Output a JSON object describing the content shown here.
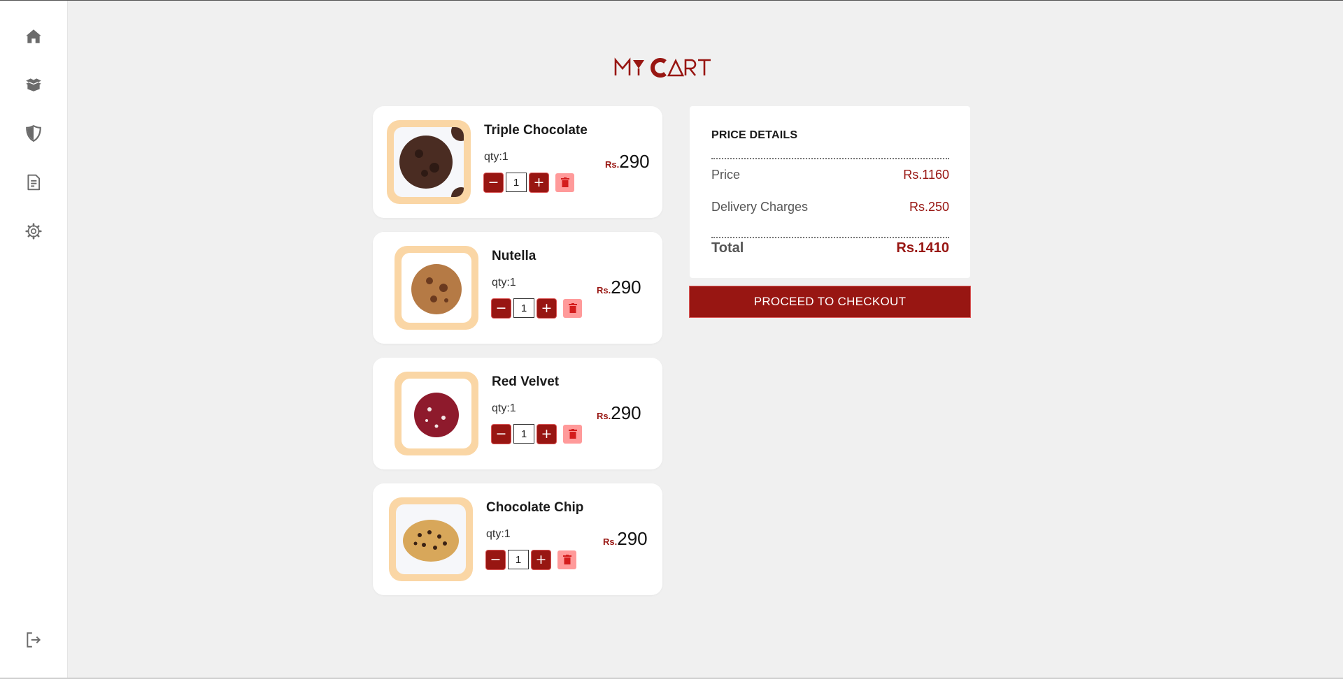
{
  "page": {
    "title": "MY CART"
  },
  "sidebar": {
    "items": [
      {
        "icon": "home-icon"
      },
      {
        "icon": "package-icon"
      },
      {
        "icon": "shield-icon"
      },
      {
        "icon": "document-icon"
      },
      {
        "icon": "gear-icon"
      }
    ],
    "logout_icon": "logout-icon"
  },
  "cart": {
    "items": [
      {
        "name": "Triple Chocolate",
        "qty_label": "qty:1",
        "qty_value": "1",
        "currency": "Rs.",
        "price": "290",
        "cookie_color": "#4a2c22"
      },
      {
        "name": "Nutella",
        "qty_label": "qty:1",
        "qty_value": "1",
        "currency": "Rs.",
        "price": "290",
        "cookie_color": "#b57a45"
      },
      {
        "name": "Red Velvet",
        "qty_label": "qty:1",
        "qty_value": "1",
        "currency": "Rs.",
        "price": "290",
        "cookie_color": "#8e1a2c"
      },
      {
        "name": "Chocolate Chip",
        "qty_label": "qty:1",
        "qty_value": "1",
        "currency": "Rs.",
        "price": "290",
        "cookie_color": "#d8a75a"
      }
    ],
    "minus_label": "−",
    "plus_label": "+"
  },
  "summary": {
    "title": "PRICE DETAILS",
    "price_label": "Price",
    "price_value": "Rs.1160",
    "delivery_label": "Delivery Charges",
    "delivery_value": "Rs.250",
    "total_label": "Total",
    "total_value": "Rs.1410",
    "checkout_label": "PROCEED TO CHECKOUT"
  },
  "colors": {
    "accent": "#981612",
    "thumb_frame": "#fad6a5",
    "delete": "#ff9a9a",
    "background": "#f0f0f0"
  }
}
